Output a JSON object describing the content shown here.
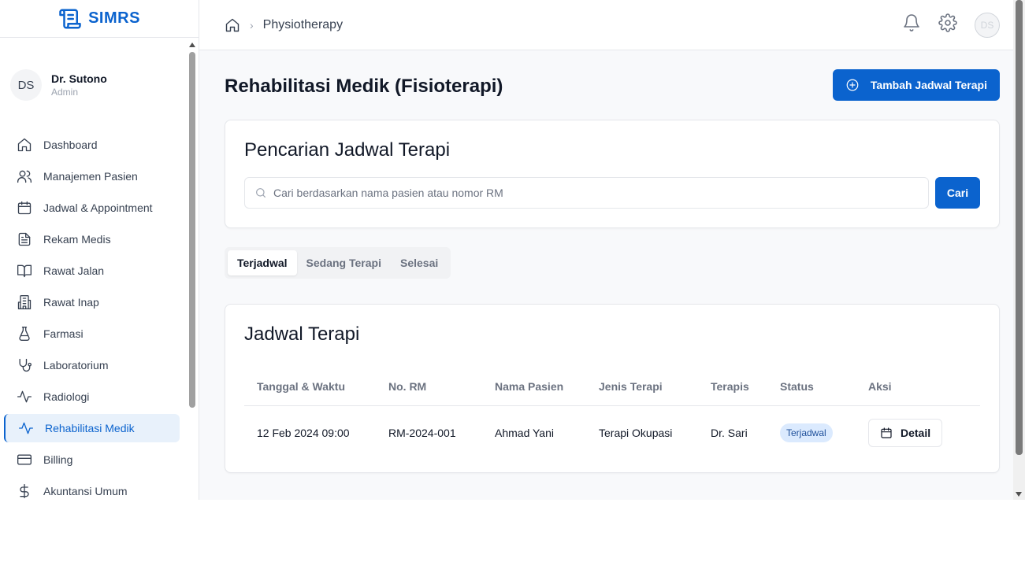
{
  "brand": {
    "name": "SIMRS",
    "icon": "scroll-icon",
    "color": "#0b63ce"
  },
  "user": {
    "initials": "DS",
    "name": "Dr. Sutono",
    "role": "Admin"
  },
  "sidebar": {
    "items": [
      {
        "label": "Dashboard",
        "icon": "home-icon"
      },
      {
        "label": "Manajemen Pasien",
        "icon": "users-icon"
      },
      {
        "label": "Jadwal & Appointment",
        "icon": "calendar-icon"
      },
      {
        "label": "Rekam Medis",
        "icon": "file-text-icon"
      },
      {
        "label": "Rawat Jalan",
        "icon": "book-open-icon"
      },
      {
        "label": "Rawat Inap",
        "icon": "building-icon"
      },
      {
        "label": "Farmasi",
        "icon": "flask-icon"
      },
      {
        "label": "Laboratorium",
        "icon": "stethoscope-icon"
      },
      {
        "label": "Radiologi",
        "icon": "activity-icon"
      },
      {
        "label": "Rehabilitasi Medik",
        "icon": "activity-icon",
        "active": true
      },
      {
        "label": "Billing",
        "icon": "credit-card-icon"
      },
      {
        "label": "Akuntansi Umum",
        "icon": "dollar-icon"
      }
    ]
  },
  "header": {
    "breadcrumb_page": "Physiotherapy",
    "avatar_initials": "DS"
  },
  "main": {
    "title": "Rehabilitasi Medik (Fisioterapi)",
    "add_button_label": "Tambah Jadwal Terapi",
    "search": {
      "title": "Pencarian Jadwal Terapi",
      "placeholder": "Cari berdasarkan nama pasien atau nomor RM",
      "button_label": "Cari"
    },
    "tabs": [
      {
        "label": "Terjadwal",
        "active": true
      },
      {
        "label": "Sedang Terapi"
      },
      {
        "label": "Selesai"
      }
    ],
    "table": {
      "title": "Jadwal Terapi",
      "columns": [
        "Tanggal & Waktu",
        "No. RM",
        "Nama Pasien",
        "Jenis Terapi",
        "Terapis",
        "Status",
        "Aksi"
      ],
      "rows": [
        {
          "datetime": "12 Feb 2024 09:00",
          "rm": "RM-2024-001",
          "patient": "Ahmad Yani",
          "therapy": "Terapi Okupasi",
          "therapist": "Dr. Sari",
          "status": "Terjadwal",
          "action": "Detail"
        }
      ]
    }
  },
  "colors": {
    "accent": "#0b63ce",
    "badge_bg": "#dbeafe",
    "active_nav_bg": "#e8f1fb"
  }
}
